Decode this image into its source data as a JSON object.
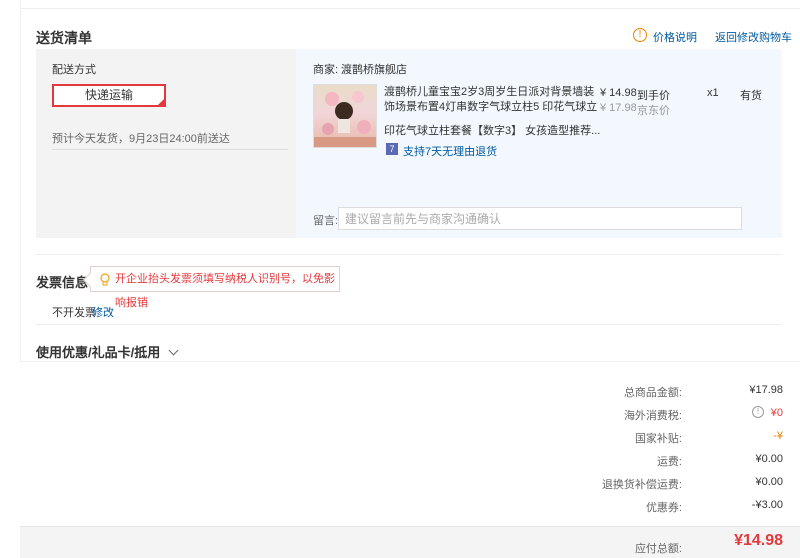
{
  "delivery": {
    "section_title": "送货清单",
    "price_note_label": "价格说明",
    "back_to_cart_label": "返回修改购物车",
    "shipping_method_label": "配送方式",
    "shipping_option": "快递运输",
    "estimate_text": "预计今天发货，9月23日24:00前送达",
    "merchant_label": "商家:",
    "merchant_name": "渡鹊桥旗舰店",
    "product": {
      "title_line1": "渡鹊桥儿童宝宝2岁3周岁生日派对背景墙装",
      "title_line2": "饰场景布置4灯串数字气球立柱5 印花气球立",
      "spec": "印花气球立柱套餐【数字3】 女孩造型推荐...",
      "price": "¥ 14.98",
      "price_tag": "到手价",
      "jd_price": "¥ 17.98",
      "jd_price_tag": "京东价",
      "quantity": "x1",
      "stock": "有货",
      "return_icon": "7",
      "return_text": "支持7天无理由退货"
    },
    "remark_label": "留言:",
    "remark_placeholder": "建议留言前先与商家沟通确认"
  },
  "invoice": {
    "title": "发票信息",
    "tip": "开企业抬头发票须填写纳税人识别号，以免影响报销",
    "status": "不开发票",
    "edit_label": "修改"
  },
  "coupon": {
    "title": "使用优惠/礼品卡/抵用"
  },
  "summary": {
    "items": [
      {
        "label": "总商品金额:",
        "value": "¥17.98"
      },
      {
        "label": "海外消费税:",
        "value": "¥0"
      },
      {
        "label": "国家补贴:",
        "value": "-¥"
      },
      {
        "label": "运费:",
        "value": "¥0.00"
      },
      {
        "label": "退换货补偿运费:",
        "value": "¥0.00"
      },
      {
        "label": "优惠券:",
        "value": "-¥3.00"
      }
    ],
    "total_label": "应付总额:",
    "total_value": "¥14.98"
  },
  "colors": {
    "accent": "#e4393c",
    "link": "#005aa0",
    "warning": "#f08200"
  }
}
